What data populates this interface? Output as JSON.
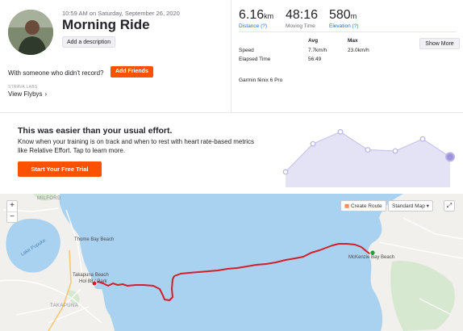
{
  "activity": {
    "datetime": "10:59 AM on Saturday, September 26, 2020",
    "title": "Morning Ride",
    "add_description": "Add a description",
    "with_someone": "With someone who didn't record?",
    "add_friends": "Add Friends",
    "strava_labs": "STRAVA LABS",
    "view_flybys": "View Flybys"
  },
  "stats": {
    "distance": {
      "value": "6.16",
      "unit": "km",
      "label": "Distance (?)"
    },
    "moving_time": {
      "value": "48:16",
      "label": "Moving Time"
    },
    "elevation": {
      "value": "580",
      "unit": "m",
      "label": "Elevation (?)"
    },
    "col_avg": "Avg",
    "col_max": "Max",
    "speed_label": "Speed",
    "speed_avg": "7.7km/h",
    "speed_max": "23.0km/h",
    "elapsed_label": "Elapsed Time",
    "elapsed_value": "56:49",
    "show_more": "Show More",
    "device": "Garmin fēnix 6 Pro"
  },
  "effort": {
    "title": "This was easier than your usual effort.",
    "text": "Know when your training is on track and when to rest with heart rate-based metrics like Relative Effort. Tap to learn more.",
    "button": "Start Your Free Trial",
    "trend_points": [
      0.15,
      0.62,
      0.82,
      0.52,
      0.5,
      0.7,
      0.4
    ],
    "colors": {
      "fill": "#e4e2f5",
      "line": "#c9c6ec",
      "dot": "#b8b4e6",
      "current": "#9b93db"
    }
  },
  "map": {
    "create_route": "Create Route",
    "map_type": "Standard Map",
    "zoom_in": "+",
    "zoom_out": "−",
    "labels": {
      "milford": "MILFORD",
      "lake": "Lake Pupuke",
      "thome_bay": "Thome Bay Beach",
      "takapuna_beach_1": "Takapuna Beach",
      "takapuna_beach_2": "Hol 88 / Park",
      "takapuna": "TAKAPUNA",
      "mckenzie": "McKenzie Bay Beach"
    },
    "colors": {
      "water": "#a9d1f0",
      "land": "#f2f0ec",
      "route": "#d61e2b",
      "end": "#1fa536"
    }
  },
  "theme": {
    "accent": "#fc5200",
    "link": "#1a73e8"
  }
}
